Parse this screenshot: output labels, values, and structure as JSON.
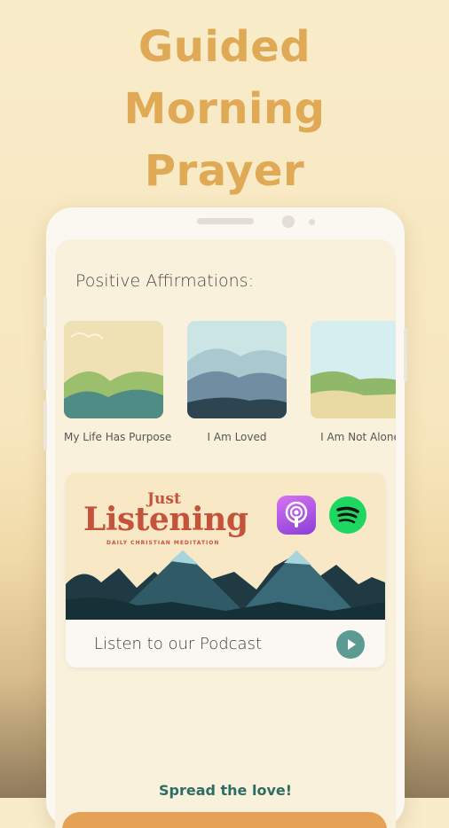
{
  "headline": {
    "lines": [
      "Guided",
      "Morning",
      "Prayer"
    ],
    "color": "#e0a955"
  },
  "screen": {
    "section_title": "Positive Affirmations:",
    "affirmations": [
      {
        "label": "My Life Has Purpose"
      },
      {
        "label": "I Am Loved"
      },
      {
        "label": "I Am Not Alone"
      }
    ],
    "podcast": {
      "art_title_small": "Just",
      "art_title_big": "Listening",
      "art_subtitle": "DAILY CHRISTIAN MEDITATION",
      "label": "Listen to our Podcast",
      "play_icon": "play-icon",
      "apple_icon": "apple-podcasts-icon",
      "spotify_icon": "spotify-icon"
    },
    "share": {
      "label": "Spread the love!"
    },
    "colors": {
      "accent_orange": "#e5a257",
      "teal": "#2e6d63",
      "play_teal": "#5c9a94",
      "podcast_red": "#c4533b"
    }
  }
}
